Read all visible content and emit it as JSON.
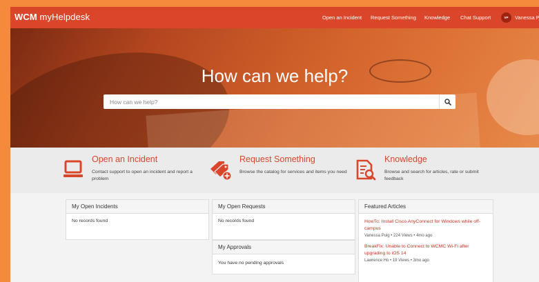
{
  "nav": {
    "brand_bold": "WCM",
    "brand_rest": "myHelpdesk",
    "links": [
      "Open an Incident",
      "Request Something",
      "Knowledge",
      "Chat Support"
    ],
    "user_initials": "VP",
    "user_name": "Vanessa Puig"
  },
  "hero": {
    "title": "How can we help?",
    "search_placeholder": "How can we help?"
  },
  "features": [
    {
      "title": "Open an Incident",
      "description": "Contact support to open an incident and report a problem",
      "icon": "laptop-icon"
    },
    {
      "title": "Request Something",
      "description": "Browse the catalog for services and items you need",
      "icon": "add-tag-icon"
    },
    {
      "title": "Knowledge",
      "description": "Browse and search for articles, rate or submit feedback",
      "icon": "document-search-icon"
    }
  ],
  "cards": {
    "incidents": {
      "title": "My Open Incidents",
      "body": "No records found"
    },
    "requests": {
      "title": "My Open Requests",
      "body": "No records found"
    },
    "approvals": {
      "title": "My Approvals",
      "body": "You have no pending approvals"
    },
    "featured": {
      "title": "Featured Articles",
      "articles": [
        {
          "title": "HowTo: Install Cisco AnyConnect for Windows while off-campus",
          "author": "Vanessa Puig",
          "views": "224 Views",
          "age": "4mo ago"
        },
        {
          "title": "BreakFix: Unable to Connect to WCMC Wi-Fi after upgrading to iOS 14",
          "author": "Lawrence Ho",
          "views": "19 Views",
          "age": "3mo ago"
        }
      ]
    }
  },
  "colors": {
    "brand": "#d9462a",
    "link": "#c4321f",
    "frame": "#f58a3c"
  }
}
